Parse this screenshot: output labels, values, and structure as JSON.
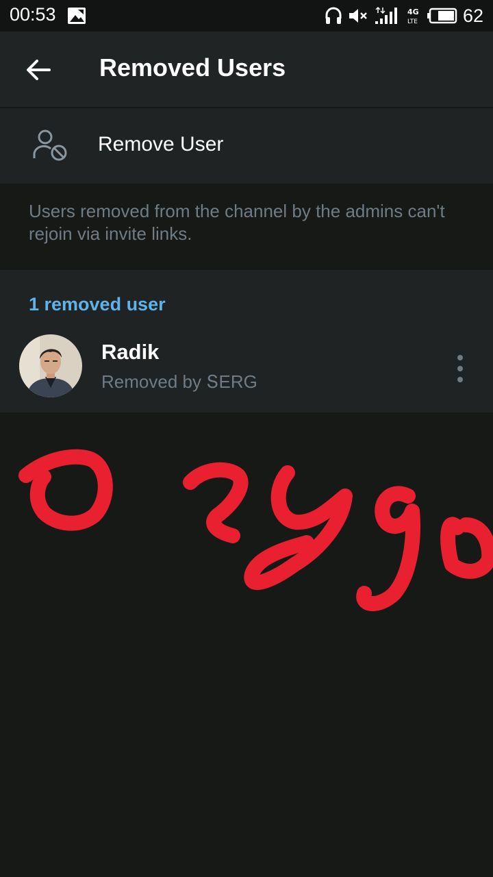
{
  "status_bar": {
    "time": "00:53",
    "network": "4G LTE",
    "battery": "62"
  },
  "app_bar": {
    "title": "Removed Users"
  },
  "remove_row": {
    "label": "Remove User"
  },
  "info": {
    "text": "Users removed from the channel by the admins can't rejoin via invite links."
  },
  "section": {
    "header": "1 removed user",
    "users": [
      {
        "name": "Radik",
        "subtitle": "Removed by ՏERG"
      }
    ]
  },
  "colors": {
    "accent": "#5fb3e8",
    "scribble": "#e8202f",
    "background": "#171917",
    "surface": "#1f2324"
  }
}
